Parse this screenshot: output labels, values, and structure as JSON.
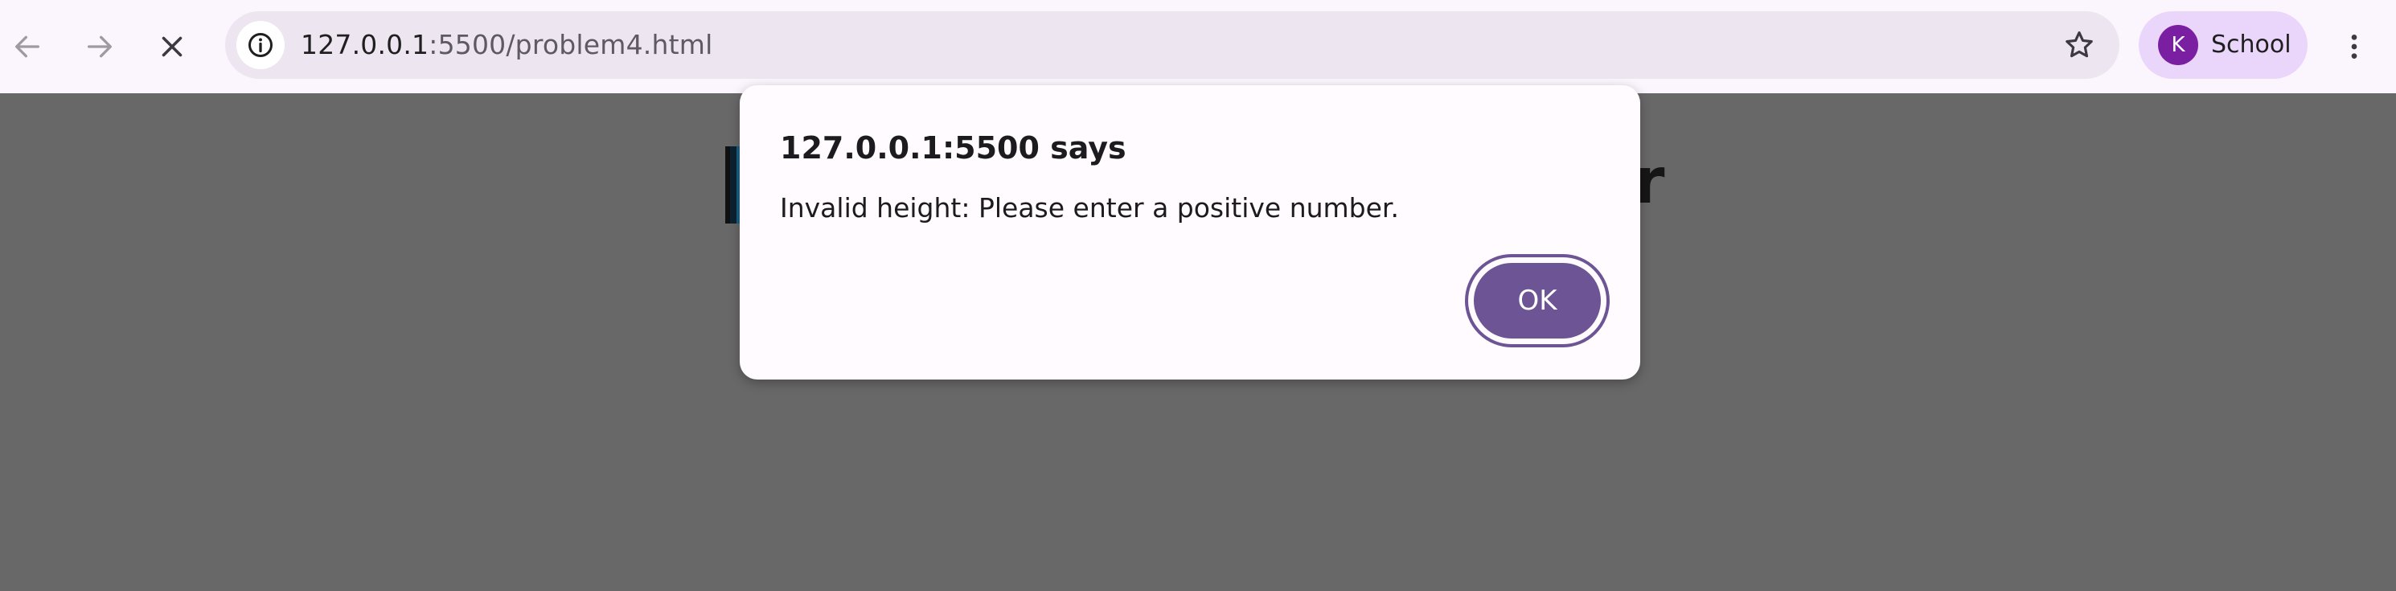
{
  "browser": {
    "url_host": "127.0.0.1",
    "url_path": ":5500/problem4.html",
    "profile_initial": "K",
    "profile_name": "School",
    "icons": {
      "back": "back-arrow-icon",
      "forward": "forward-arrow-icon",
      "stop": "close-icon",
      "site_info": "info-icon",
      "bookmark": "star-icon",
      "menu": "kebab-menu-icon"
    }
  },
  "page": {
    "heading_tail": "r"
  },
  "dialog": {
    "title": "127.0.0.1:5500 says",
    "message": "Invalid height: Please enter a positive number.",
    "ok_label": "OK"
  },
  "colors": {
    "overlay": "#686868",
    "toolbar_bg": "#fbf6fd",
    "omnibox_bg": "#ede6f1",
    "profile_chip_bg": "#ead5fb",
    "avatar_bg": "#7b1fa2",
    "dialog_bg": "#fffbfe",
    "ok_button_bg": "#6d5495"
  }
}
